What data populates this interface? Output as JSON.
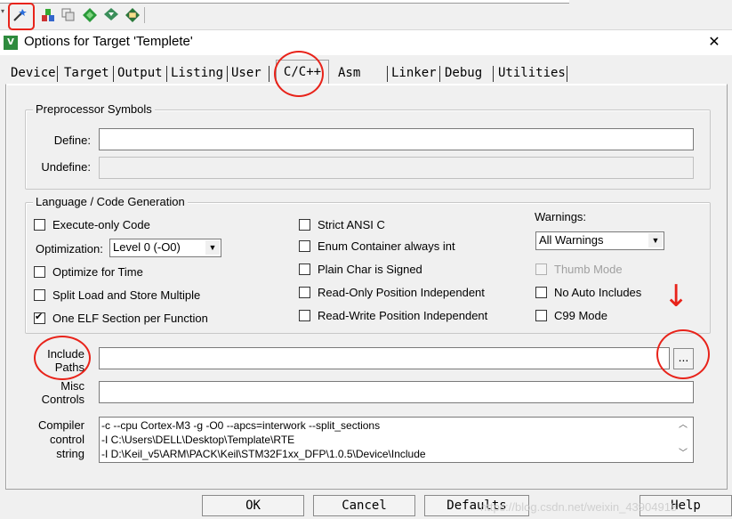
{
  "dialog": {
    "title": "Options for Target 'Templete'",
    "close_glyph": "✕"
  },
  "tabs": [
    {
      "label": "Device"
    },
    {
      "label": "Target"
    },
    {
      "label": "Output"
    },
    {
      "label": "Listing"
    },
    {
      "label": "User"
    },
    {
      "label": "C/C++",
      "active": true
    },
    {
      "label": "Asm"
    },
    {
      "label": "Linker"
    },
    {
      "label": "Debug"
    },
    {
      "label": "Utilities"
    }
  ],
  "preprocessor": {
    "group_title": "Preprocessor Symbols",
    "define_label": "Define:",
    "define_value": "",
    "undefine_label": "Undefine:",
    "undefine_value": ""
  },
  "language": {
    "group_title": "Language / Code Generation",
    "execute_only": {
      "label": "Execute-only Code",
      "checked": false
    },
    "optimization_label": "Optimization:",
    "optimization_value": "Level 0 (-O0)",
    "optimize_time": {
      "label": "Optimize for Time",
      "checked": false
    },
    "split_load": {
      "label": "Split Load and Store Multiple",
      "checked": false
    },
    "one_elf": {
      "label": "One ELF Section per Function",
      "checked": true
    },
    "strict_ansi": {
      "label": "Strict ANSI C",
      "checked": false
    },
    "enum_container": {
      "label": "Enum Container always int",
      "checked": false
    },
    "plain_char": {
      "label": "Plain Char is Signed",
      "checked": false
    },
    "ro_pi": {
      "label": "Read-Only Position Independent",
      "checked": false
    },
    "rw_pi": {
      "label": "Read-Write Position Independent",
      "checked": false
    },
    "warnings_label": "Warnings:",
    "warnings_value": "All Warnings",
    "thumb_mode": {
      "label": "Thumb Mode",
      "checked": false,
      "disabled": true
    },
    "no_auto_includes": {
      "label": "No Auto Includes",
      "checked": false
    },
    "c99_mode": {
      "label": "C99 Mode",
      "checked": false
    }
  },
  "include_paths": {
    "label_line1": "Include",
    "label_line2": "Paths",
    "value": "",
    "browse_label": "..."
  },
  "misc_controls": {
    "label_line1": "Misc",
    "label_line2": "Controls",
    "value": ""
  },
  "compiler_control": {
    "label_line1": "Compiler",
    "label_line2": "control",
    "label_line3": "string",
    "lines": [
      "-c --cpu Cortex-M3 -g -O0 --apcs=interwork --split_sections",
      "-I C:\\Users\\DELL\\Desktop\\Template\\RTE",
      "-I D:\\Keil_v5\\ARM\\PACK\\Keil\\STM32F1xx_DFP\\1.0.5\\Device\\Include"
    ]
  },
  "buttons": {
    "ok": "OK",
    "cancel": "Cancel",
    "defaults": "Defaults",
    "help": "Help"
  },
  "annotations": {
    "arrow_glyph": "↓",
    "color": "#e8231a"
  },
  "watermark": "https://blog.csdn.net/weixin_43904918",
  "icons": [
    "magic-wand-icon",
    "load-icon",
    "copy-icon",
    "diamond-icon",
    "download-icon",
    "manage-icon"
  ]
}
